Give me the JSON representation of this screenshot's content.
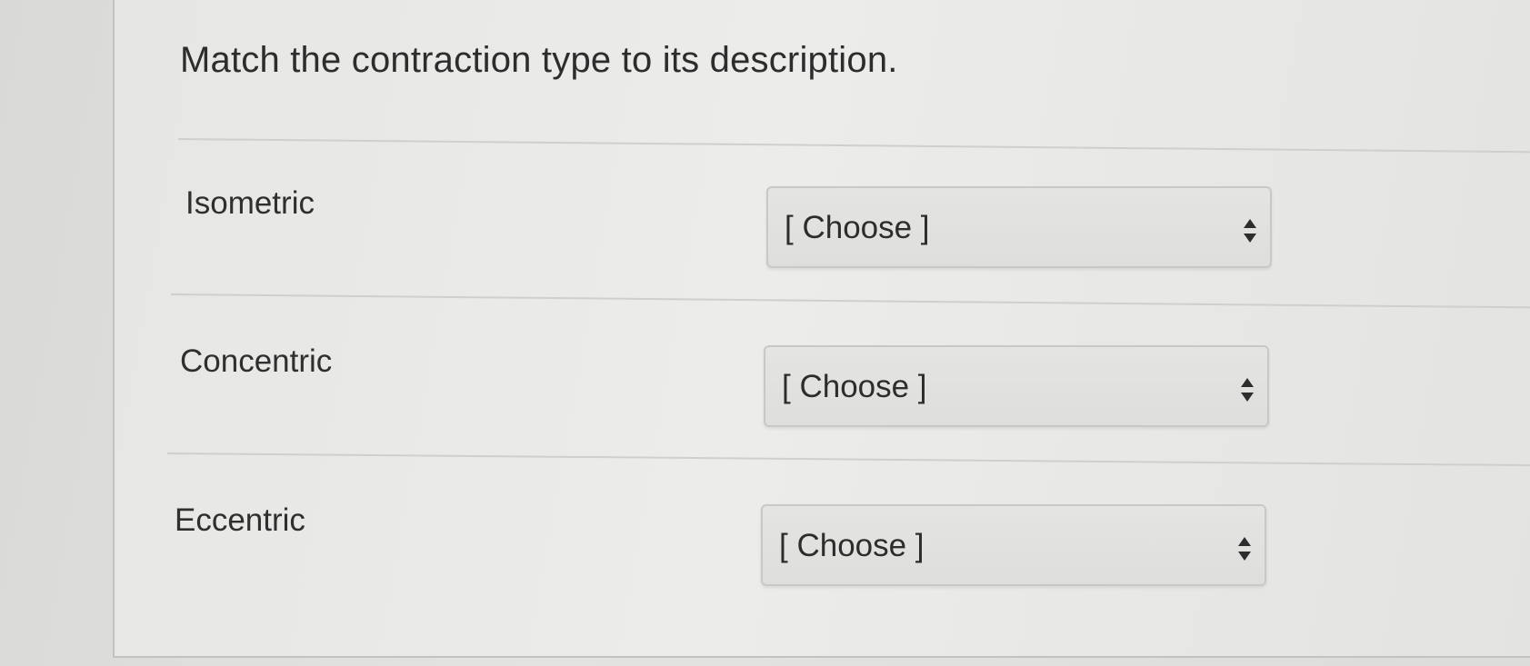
{
  "question": {
    "text": "Match the contraction type to its description."
  },
  "rows": [
    {
      "label": "Isometric",
      "select": {
        "value": "[ Choose ]",
        "icon": "sort-arrows-icon"
      }
    },
    {
      "label": "Concentric",
      "select": {
        "value": "[ Choose ]",
        "icon": "sort-arrows-icon"
      }
    },
    {
      "label": "Eccentric",
      "select": {
        "value": "[ Choose ]",
        "icon": "sort-arrows-icon"
      }
    }
  ],
  "colors": {
    "text": "#2d2d2d",
    "divider": "#cfcfcd",
    "select_border": "#c8c8c6"
  }
}
